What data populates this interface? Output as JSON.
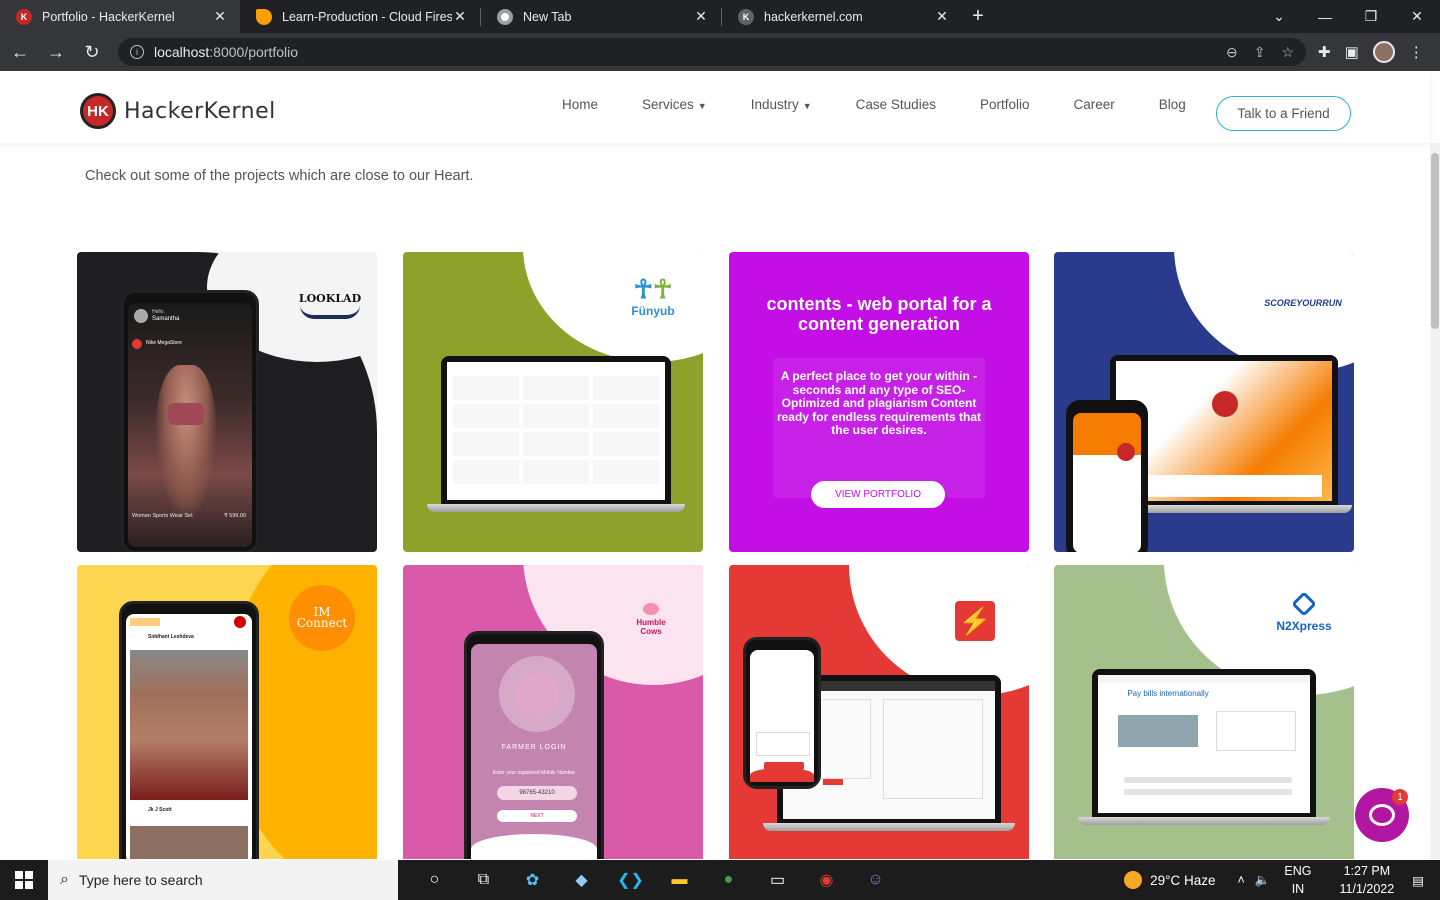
{
  "browser": {
    "tabs": [
      {
        "title": "Portfolio - HackerKernel",
        "active": true,
        "favicon_color": "#c62828",
        "favicon_letter": "K"
      },
      {
        "title": "Learn-Production - Cloud Firesto",
        "active": false,
        "favicon_color": "#ffa000",
        "favicon_letter": ""
      },
      {
        "title": "New Tab",
        "active": false,
        "favicon_color": "#5f6368",
        "favicon_letter": ""
      },
      {
        "title": "hackerkernel.com",
        "active": false,
        "favicon_color": "#5f6368",
        "favicon_letter": "K"
      }
    ],
    "url_host": "localhost",
    "url_rest": ":8000/portfolio"
  },
  "site": {
    "logo_mark": "HK",
    "logo_text": "HackerKernel",
    "nav": [
      {
        "label": "Home",
        "dropdown": false
      },
      {
        "label": "Services",
        "dropdown": true
      },
      {
        "label": "Industry",
        "dropdown": true
      },
      {
        "label": "Case Studies",
        "dropdown": false
      },
      {
        "label": "Portfolio",
        "dropdown": false
      },
      {
        "label": "Career",
        "dropdown": false
      },
      {
        "label": "Blog",
        "dropdown": false
      }
    ],
    "cta": "Talk to a Friend",
    "intro": "Check out some of the projects which are close to our Heart."
  },
  "portfolio": {
    "lookload": {
      "brand": "LOOKLAD",
      "greeting": "Hello,",
      "user": "Samantha",
      "store": "Nike MegaStore",
      "caption": "Women Sports Wear Set",
      "price": "₹ 599.00"
    },
    "funyub": {
      "brand": "Fünyub"
    },
    "contents": {
      "title": "contents - web portal for a content generation",
      "desc": "A perfect place to get your within - seconds and any type of SEO-Optimized and plagiarism Content ready for endless requirements that the user desires.",
      "button": "VIEW PORTFOLIO"
    },
    "scoreyourrun": {
      "brand": "SCOREYOURRUN"
    },
    "imconnect": {
      "brand": "IM Connect",
      "user": "Siddhant Leshdeva",
      "user2": "Jk J Scott"
    },
    "humblecows": {
      "brand": "Humble Cows",
      "title": "FARMER LOGIN",
      "prompt": "Enter your registered Mobile Number",
      "phone": "98765-43210",
      "button": "NEXT"
    },
    "thunder": {
      "brand": ""
    },
    "n2xpress": {
      "brand": "N2Xpress",
      "headline": "Pay bills internationally"
    }
  },
  "chat": {
    "badge": "1"
  },
  "taskbar": {
    "search_placeholder": "Type here to search",
    "weather": "29°C  Haze",
    "lang1": "ENG",
    "lang2": "IN",
    "time": "1:27 PM",
    "date": "11/1/2022"
  }
}
